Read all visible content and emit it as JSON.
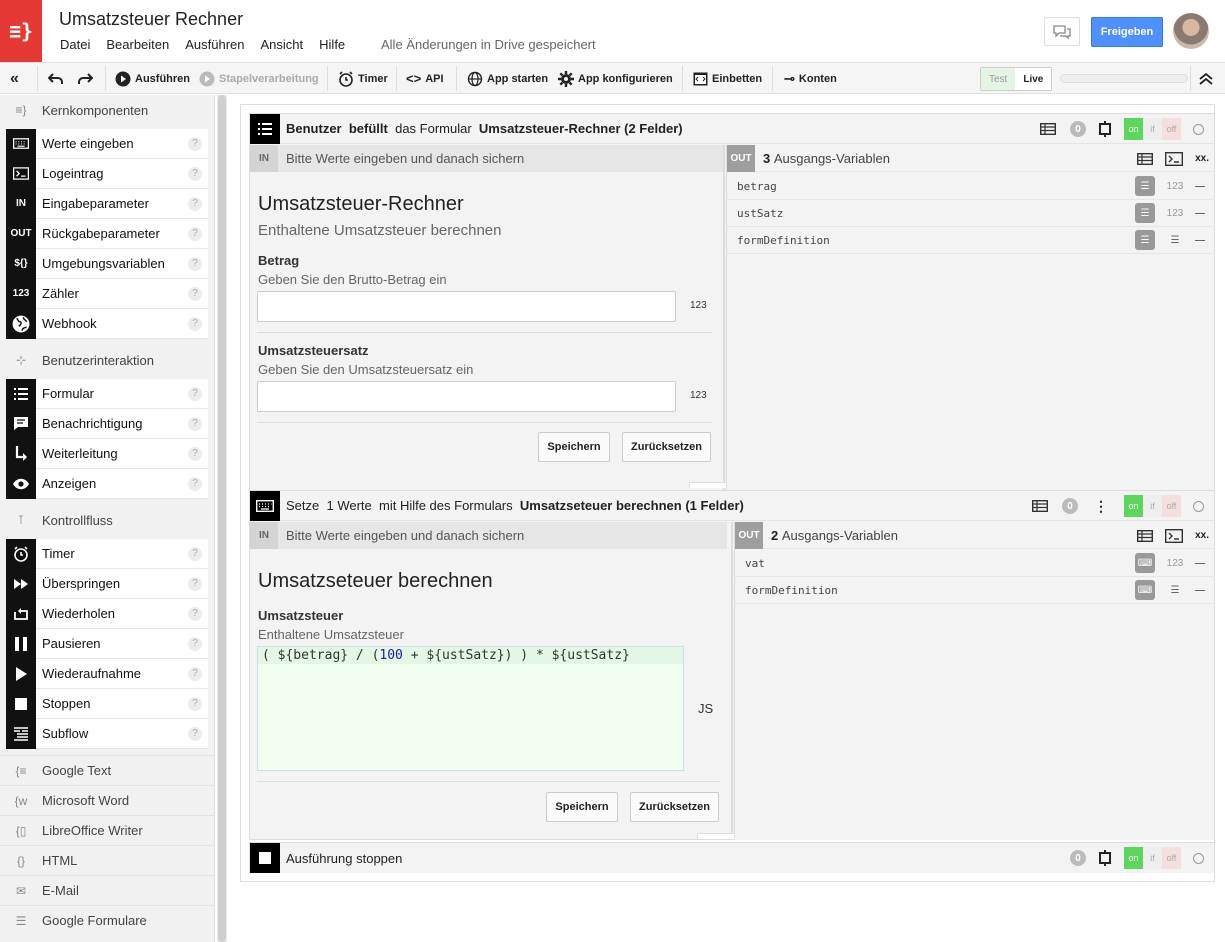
{
  "app": {
    "logo": "≡}",
    "title": "Umsatzsteuer Rechner",
    "save_status": "Alle Änderungen in Drive gespeichert",
    "share_label": "Freigeben"
  },
  "menu": [
    "Datei",
    "Bearbeiten",
    "Ausführen",
    "Ansicht",
    "Hilfe"
  ],
  "toolbar": {
    "run": "Ausführen",
    "batch": "Stapelverarbeitung",
    "timer": "Timer",
    "api": "API",
    "start_app": "App starten",
    "configure_app": "App konfigurieren",
    "embed": "Einbetten",
    "accounts": "Konten",
    "test": "Test",
    "live": "Live"
  },
  "sidebar": {
    "groups": [
      {
        "label": "Kernkomponenten",
        "icon": "braces-icon"
      },
      {
        "label": "Benutzerinteraktion",
        "icon": "user-icon"
      },
      {
        "label": "Kontrollfluss",
        "icon": "flow-icon"
      }
    ],
    "core": [
      {
        "label": "Werte eingeben",
        "icon": "keyboard-icon"
      },
      {
        "label": "Logeintrag",
        "icon": "terminal-icon"
      },
      {
        "label": "Eingabeparameter",
        "icon": "in-icon",
        "glyph": "IN"
      },
      {
        "label": "Rückgabeparameter",
        "icon": "out-icon",
        "glyph": "OUT"
      },
      {
        "label": "Umgebungsvariablen",
        "icon": "env-icon",
        "glyph": "${}"
      },
      {
        "label": "Zähler",
        "icon": "counter-icon",
        "glyph": "123"
      },
      {
        "label": "Webhook",
        "icon": "globe-icon"
      }
    ],
    "user": [
      {
        "label": "Formular",
        "icon": "list-icon"
      },
      {
        "label": "Benachrichtigung",
        "icon": "message-icon"
      },
      {
        "label": "Weiterleitung",
        "icon": "redirect-icon"
      },
      {
        "label": "Anzeigen",
        "icon": "eye-icon"
      }
    ],
    "flow": [
      {
        "label": "Timer",
        "icon": "clock-icon"
      },
      {
        "label": "Überspringen",
        "icon": "skip-icon"
      },
      {
        "label": "Wiederholen",
        "icon": "repeat-icon"
      },
      {
        "label": "Pausieren",
        "icon": "pause-icon"
      },
      {
        "label": "Wiederaufnahme",
        "icon": "play-icon"
      },
      {
        "label": "Stoppen",
        "icon": "stop-icon"
      },
      {
        "label": "Subflow",
        "icon": "subflow-icon"
      }
    ],
    "templates": [
      {
        "label": "Google Text",
        "glyph": "{≡"
      },
      {
        "label": "Microsoft Word",
        "glyph": "{w"
      },
      {
        "label": "LibreOffice Writer",
        "glyph": "{▯"
      },
      {
        "label": "HTML",
        "glyph": "{}"
      },
      {
        "label": "E-Mail",
        "glyph": "✉"
      },
      {
        "label": "Google Formulare",
        "glyph": "☰"
      }
    ],
    "help": "?"
  },
  "block1": {
    "title_parts": [
      "Benutzer",
      "befüllt",
      "das Formular",
      "Umsatzsteuer-Rechner (2 Felder)"
    ],
    "count": "0",
    "in_tag": "IN",
    "in_hint": "Bitte Werte eingeben und danach sichern",
    "form_title": "Umsatzsteuer-Rechner",
    "form_subtitle": "Enthaltene Umsatzsteuer berechnen",
    "fields": [
      {
        "label": "Betrag",
        "desc": "Geben Sie den Brutto-Betrag ein",
        "type": "123"
      },
      {
        "label": "Umsatzsteuersatz",
        "desc": "Geben Sie den Umsatzsteuersatz ein",
        "type": "123"
      }
    ],
    "save": "Speichern",
    "reset": "Zurücksetzen",
    "out_tag": "OUT",
    "out_count": "3",
    "out_label": "Ausgangs-Variablen",
    "outputs": [
      {
        "name": "betrag",
        "type": "123"
      },
      {
        "name": "ustSatz",
        "type": "123"
      },
      {
        "name": "formDefinition",
        "type": "list"
      }
    ]
  },
  "block2": {
    "title_parts": [
      "Setze",
      "1 Werte",
      "mit Hilfe des Formulars",
      "Umsatzseteuer berechnen (1 Felder)"
    ],
    "count": "0",
    "in_tag": "IN",
    "in_hint": "Bitte Werte eingeben und danach sichern",
    "form_title": "Umsatzseteuer berechnen",
    "field_label": "Umsatzsteuer",
    "field_desc": "Enthaltene Umsatzsteuer",
    "code": {
      "p1": "( ${betrag} / (",
      "num": "100",
      "p2": " + ${ustSatz}) ) * ${ustSatz}"
    },
    "js": "JS",
    "save": "Speichern",
    "reset": "Zurücksetzen",
    "out_tag": "OUT",
    "out_count": "2",
    "out_label": "Ausgangs-Variablen",
    "outputs": [
      {
        "name": "vat",
        "type": "123"
      },
      {
        "name": "formDefinition",
        "type": "list"
      }
    ]
  },
  "block3": {
    "title": "Ausführung stoppen",
    "count": "0"
  },
  "toggles": {
    "on": "on",
    "if": "if",
    "off": "off",
    "xx": "xx."
  }
}
